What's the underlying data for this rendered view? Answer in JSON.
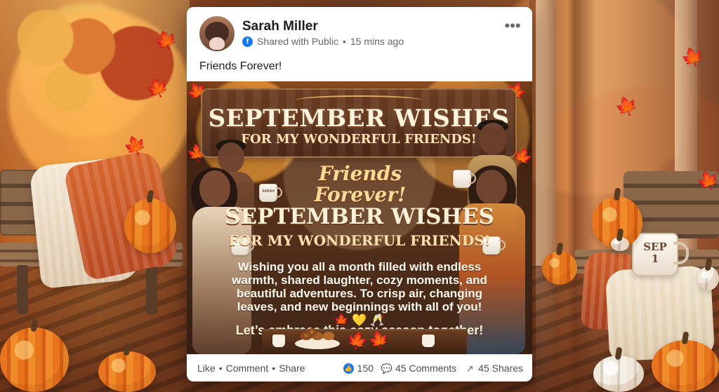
{
  "post": {
    "author_name": "Sarah Miller",
    "privacy_text": "Shared with Public",
    "time_text": "15 mins ago",
    "caption": "Friends Forever!"
  },
  "greeting_image": {
    "headline_main": "SEPTEMBER WISHES",
    "headline_sub": "FOR MY WONDERFUL FRIENDS!",
    "banner": "Friends Forever!",
    "mid_headline": "SEPTEMBER WISHES",
    "mid_subheadline": "FOR MY WONDERFUL FRIENDS!",
    "message": "Wishing you all a month filled with endless warmth, shared laughter, cozy moments, and beautiful adventures. To crisp air, changing leaves, and new beginnings with all of you! 🍁 💛 🥂",
    "closing": "Let’s embrace this cozy season together!",
    "cup_label": "SARAH"
  },
  "background_mug": {
    "label": "SEP\n1"
  },
  "footer": {
    "like": "Like",
    "comment": "Comment",
    "share": "Share",
    "reactions_count": "150",
    "comments_count": "45 Comments",
    "shares_count": "45 Shares",
    "separator": "•"
  },
  "icons": {
    "public": "globe-icon",
    "more": "more-options-icon",
    "like": "like-icon",
    "comment": "comment-icon",
    "share": "share-icon",
    "leaf": "maple-leaf-icon"
  },
  "colors": {
    "facebook_blue": "#1877f2",
    "post_text": "#1c1e21",
    "secondary_text": "#65676b",
    "wood_brown": "#4b2717",
    "autumn_orange": "#e8751d"
  }
}
